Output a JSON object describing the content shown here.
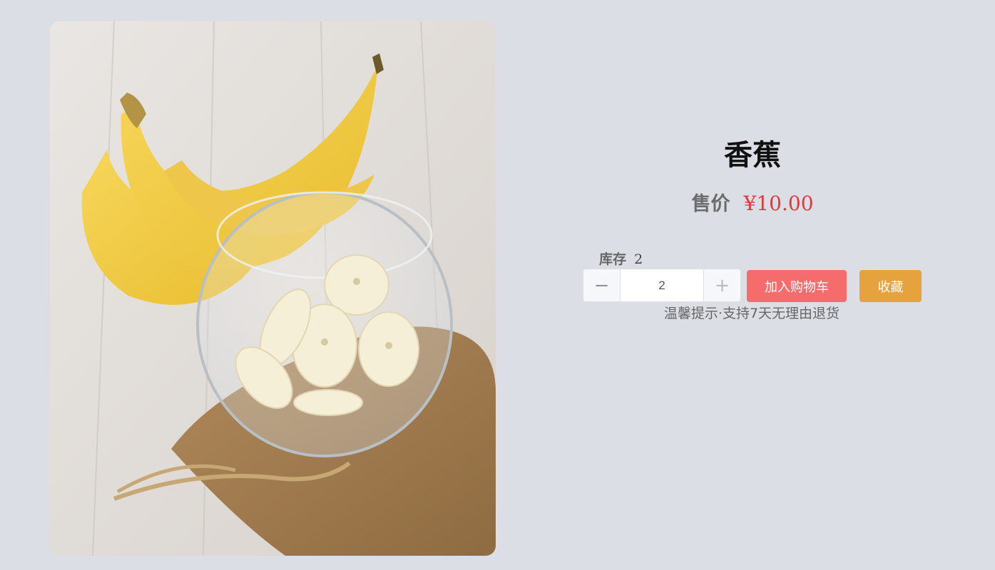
{
  "product": {
    "name": "香蕉",
    "price_label": "售价",
    "price": "¥10.00",
    "stock_label": "库存",
    "stock": "2"
  },
  "quantity": {
    "value": "2",
    "minus_symbol": "−",
    "plus_symbol": "+"
  },
  "actions": {
    "add_to_cart": "加入购物车",
    "favorite": "收藏"
  },
  "tip": "温馨提示·支持7天无理由退货",
  "colors": {
    "background": "#dcdee5",
    "price": "#e03a3a",
    "cart_button": "#f56c6c",
    "favorite_button": "#e6a23c"
  }
}
